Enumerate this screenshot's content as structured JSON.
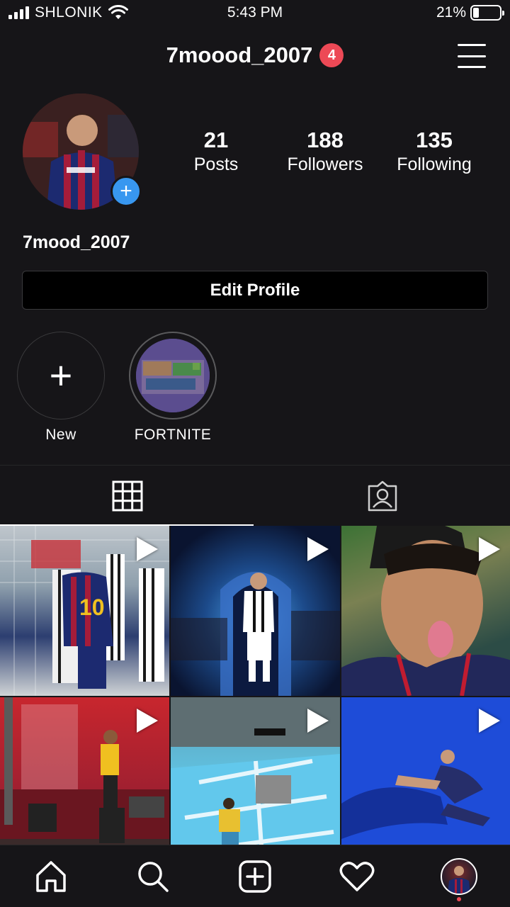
{
  "status_bar": {
    "carrier": "SHLONIK",
    "time": "5:43 PM",
    "battery_percent": "21%",
    "battery_level": 0.21,
    "icons": [
      "signal-icon",
      "wifi-icon",
      "battery-icon"
    ]
  },
  "header": {
    "username": "7moood_2007",
    "notification_count": "4",
    "menu_icon": "hamburger-menu-icon"
  },
  "profile": {
    "display_name": "7mood_2007",
    "add_story_icon": "plus-icon",
    "stats": [
      {
        "value": "21",
        "label": "Posts"
      },
      {
        "value": "188",
        "label": "Followers"
      },
      {
        "value": "135",
        "label": "Following"
      }
    ],
    "edit_profile_label": "Edit Profile"
  },
  "highlights": [
    {
      "label": "New",
      "icon": "plus-icon"
    },
    {
      "label": "FORTNITE"
    }
  ],
  "tabs": [
    {
      "icon": "grid-icon",
      "active": true
    },
    {
      "icon": "tagged-person-icon",
      "active": false
    }
  ],
  "grid": {
    "tiles": [
      {
        "type": "video"
      },
      {
        "type": "video"
      },
      {
        "type": "video"
      },
      {
        "type": "video"
      },
      {
        "type": "video"
      },
      {
        "type": "video"
      }
    ]
  },
  "bottom_nav": [
    "home-icon",
    "search-icon",
    "new-post-icon",
    "activity-heart-icon",
    "profile-avatar"
  ],
  "colors": {
    "background": "#161518",
    "accent_blue": "#3897f0",
    "badge_red": "#ed4956",
    "border": "#3a3a3c"
  }
}
